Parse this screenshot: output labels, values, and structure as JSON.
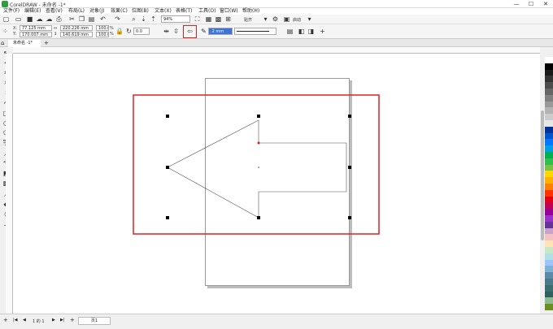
{
  "titlebar": {
    "title": "CorelDRAW - 未命名 -1*",
    "min": "—",
    "max": "☐",
    "close": "✕"
  },
  "menu": [
    "文件(F)",
    "编辑(E)",
    "查看(V)",
    "布局(L)",
    "对象(J)",
    "效果(C)",
    "位图(B)",
    "文本(X)",
    "表格(T)",
    "工具(O)",
    "窗口(W)",
    "帮助(H)"
  ],
  "toolbar1": {
    "zoom": "94%",
    "snap_label": "贴齐",
    "launch_label": "启动"
  },
  "toolbar2": {
    "x_label": "X:",
    "x_value": "77.125 mm",
    "y_label": "Y:",
    "y_value": "170.007 mm",
    "w_value": "220.226 mm",
    "h_value": "140.619 mm",
    "scale_w": "100.0",
    "scale_h": "100.0",
    "pct": "%",
    "rotation": "0.0",
    "outline_width": ".2 mm"
  },
  "doc_tab": {
    "label": "未命名 -1*",
    "add": "+"
  },
  "statusbar": {
    "page_counter": "1 的 1",
    "page_tab": "页1"
  },
  "palette": [
    "#ffffff",
    "#000000",
    "#1a1a1a",
    "#333333",
    "#4d4d4d",
    "#666666",
    "#808080",
    "#999999",
    "#b3b3b3",
    "#cccccc",
    "#e6e6e6",
    "#003399",
    "#0055cc",
    "#0077ff",
    "#00a0e9",
    "#00b050",
    "#2fbf4f",
    "#7ac143",
    "#ffd700",
    "#ffb000",
    "#ff7f00",
    "#ff3300",
    "#e60012",
    "#c00050",
    "#990099",
    "#9933cc",
    "#663399",
    "#c8a2c8",
    "#f4c2c2",
    "#ffe4b5",
    "#c7e8c7",
    "#b0e0e6",
    "#a0c4ff",
    "#7fb3d5",
    "#5d8aa8",
    "#4a7a8c",
    "#3b6e6e",
    "#2f5f5f",
    "#8fbc8f",
    "#6b8e23"
  ]
}
